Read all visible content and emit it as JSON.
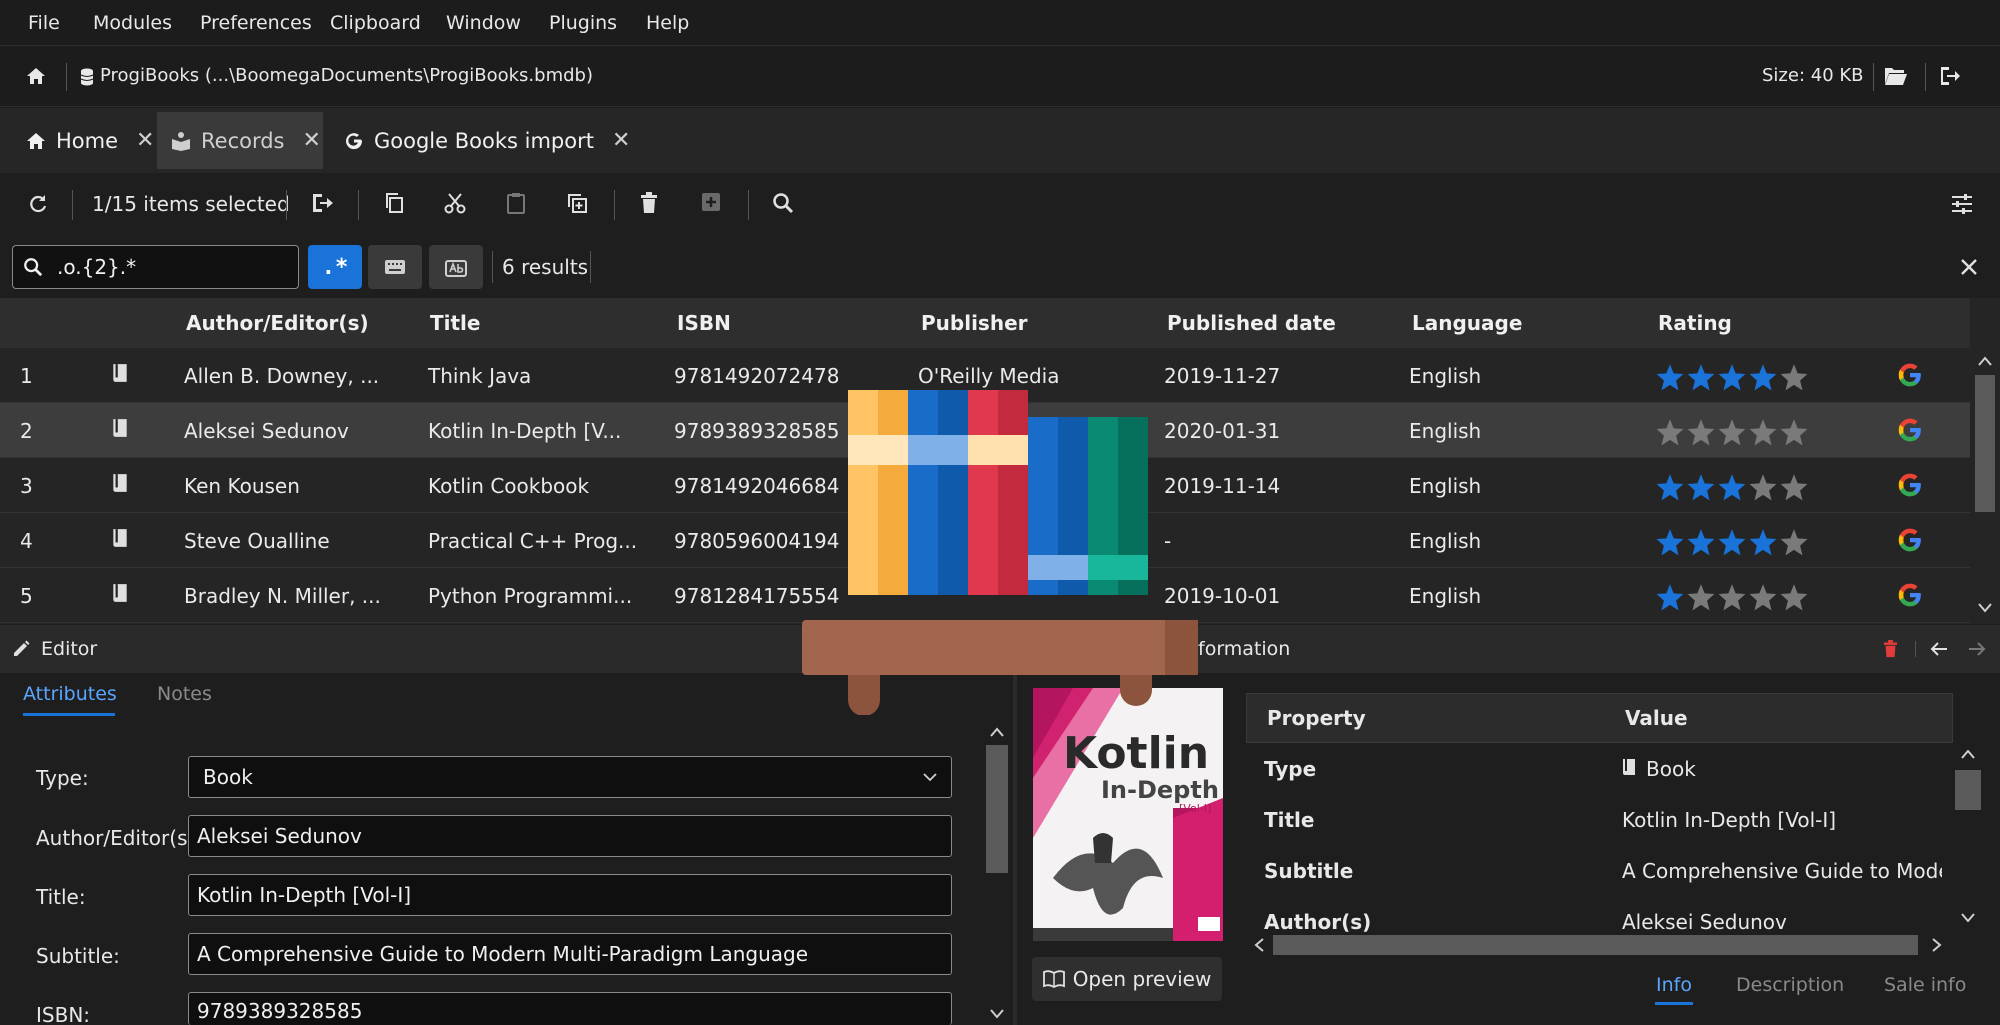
{
  "menu": [
    "File",
    "Modules",
    "Preferences",
    "Clipboard",
    "Window",
    "Plugins",
    "Help"
  ],
  "pathbar": {
    "db_path": "ProgiBooks (...\\BoomegaDocuments\\ProgiBooks.bmdb)",
    "size": "Size: 40 KB"
  },
  "tabs": [
    {
      "label": "Home",
      "icon": "home-icon"
    },
    {
      "label": "Records",
      "icon": "book-reader-icon"
    },
    {
      "label": "Google Books import",
      "icon": "google-g-icon"
    }
  ],
  "toolbar": {
    "selection": "1/15 items selected"
  },
  "search": {
    "query": ".o.{2}.*",
    "results": "6 results"
  },
  "table": {
    "headers": [
      "Author/Editor(s)",
      "Title",
      "ISBN",
      "Publisher",
      "Published date",
      "Language",
      "Rating"
    ],
    "rows": [
      {
        "n": "1",
        "author": "Allen B. Downey, ...",
        "title": "Think Java",
        "isbn": "9781492072478",
        "publisher": "O'Reilly Media",
        "date": "2019-11-27",
        "lang": "English",
        "rating": 4
      },
      {
        "n": "2",
        "author": "Aleksei Sedunov",
        "title": "Kotlin In-Depth [V...",
        "isbn": "9789389328585",
        "publisher": "",
        "date": "2020-01-31",
        "lang": "English",
        "rating": 0
      },
      {
        "n": "3",
        "author": "Ken Kousen",
        "title": "Kotlin Cookbook",
        "isbn": "9781492046684",
        "publisher": "",
        "date": "2019-11-14",
        "lang": "English",
        "rating": 3
      },
      {
        "n": "4",
        "author": "Steve Oualline",
        "title": "Practical C++ Prog...",
        "isbn": "9780596004194",
        "publisher": "",
        "date": "-",
        "lang": "English",
        "rating": 4
      },
      {
        "n": "5",
        "author": "Bradley N. Miller, ...",
        "title": "Python Programmi...",
        "isbn": "9781284175554",
        "publisher": "",
        "date": "2019-10-01",
        "lang": "English",
        "rating": 1
      }
    ]
  },
  "editor": {
    "title": "Editor",
    "tabs": [
      "Attributes",
      "Notes"
    ],
    "fields": [
      {
        "label": "Type:",
        "value": "Book"
      },
      {
        "label": "Author/Editor(s):",
        "value": "Aleksei Sedunov"
      },
      {
        "label": "Title:",
        "value": "Kotlin In-Depth [Vol-I]"
      },
      {
        "label": "Subtitle:",
        "value": "A Comprehensive Guide to Modern Multi-Paradigm Language"
      },
      {
        "label": "ISBN:",
        "value": "9789389328585"
      }
    ]
  },
  "info": {
    "title_partial": "formation",
    "cover": {
      "main": "Kotlin",
      "sub": "In-Depth",
      "vol": "[Vol-I]"
    },
    "open_preview": "Open preview",
    "headers": [
      "Property",
      "Value"
    ],
    "rows": [
      {
        "k": "Type",
        "v": "Book"
      },
      {
        "k": "Title",
        "v": "Kotlin In-Depth [Vol-I]"
      },
      {
        "k": "Subtitle",
        "v": "A Comprehensive Guide to Mode"
      },
      {
        "k": "Author(s)",
        "v": "Aleksei Sedunov"
      }
    ],
    "tabs": [
      "Info",
      "Description",
      "Sale info"
    ]
  },
  "colors": {
    "accent": "#1a73d9",
    "star": "#1a73d9",
    "star_off": "#7a7a7a"
  }
}
